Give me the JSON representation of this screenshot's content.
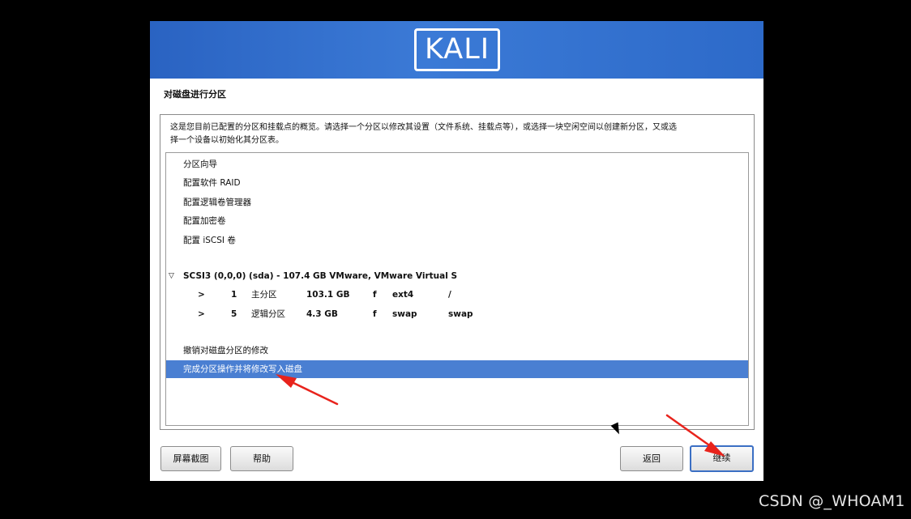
{
  "brand": {
    "logo_text": "KALI"
  },
  "page": {
    "title": "对磁盘进行分区"
  },
  "description": {
    "line1": "这是您目前已配置的分区和挂载点的概览。请选择一个分区以修改其设置（文件系统、挂载点等），或选择一块空闲空间以创建新分区，又或选",
    "line2": "择一个设备以初始化其分区表。"
  },
  "menu_items": [
    {
      "label": "分区向导"
    },
    {
      "label": "配置软件 RAID"
    },
    {
      "label": "配置逻辑卷管理器"
    },
    {
      "label": "配置加密卷"
    },
    {
      "label": "配置 iSCSI 卷"
    }
  ],
  "device": {
    "expander": "▽",
    "label": "SCSI3 (0,0,0) (sda) - 107.4 GB VMware, VMware Virtual S"
  },
  "partitions": [
    {
      "marker": ">",
      "number": "1",
      "type": "主分区",
      "size": "103.1 GB",
      "flag": "f",
      "fs": "ext4",
      "mount": "/"
    },
    {
      "marker": ">",
      "number": "5",
      "type": "逻辑分区",
      "size": "4.3 GB",
      "flag": "f",
      "fs": "swap",
      "mount": "swap"
    }
  ],
  "actions": {
    "undo": "撤销对磁盘分区的修改",
    "finish": "完成分区操作并将修改写入磁盘"
  },
  "buttons": {
    "screenshot": "屏幕截图",
    "help": "帮助",
    "back": "返回",
    "continue": "继续"
  },
  "watermark": "CSDN @_WHOAM1",
  "colors": {
    "banner": "#2d6ac9",
    "selection": "#4a7fd2",
    "annotation": "#e8231c"
  }
}
